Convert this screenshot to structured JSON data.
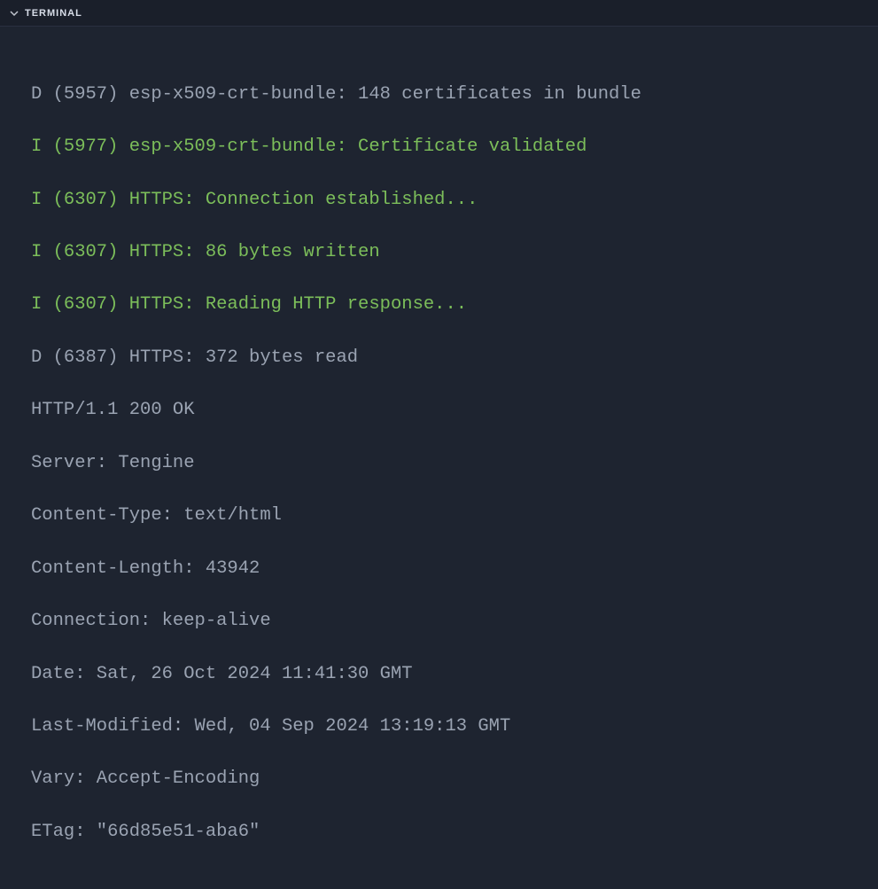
{
  "header": {
    "title": "TERMINAL"
  },
  "lines": {
    "l0": "D (5957) esp-x509-crt-bundle: 148 certificates in bundle",
    "l1": "I (5977) esp-x509-crt-bundle: Certificate validated",
    "l2": "I (6307) HTTPS: Connection established...",
    "l3": "I (6307) HTTPS: 86 bytes written",
    "l4": "I (6307) HTTPS: Reading HTTP response...",
    "l5": "D (6387) HTTPS: 372 bytes read",
    "l6": "HTTP/1.1 200 OK",
    "l7": "Server: Tengine",
    "l8": "Content-Type: text/html",
    "l9": "Content-Length: 43942",
    "l10": "Connection: keep-alive",
    "l11": "Date: Sat, 26 Oct 2024 11:41:30 GMT",
    "l12": "Last-Modified: Wed, 04 Sep 2024 13:19:13 GMT",
    "l13": "Vary: Accept-Encoding",
    "l14": "ETag: \"66d85e51-aba6\""
  }
}
